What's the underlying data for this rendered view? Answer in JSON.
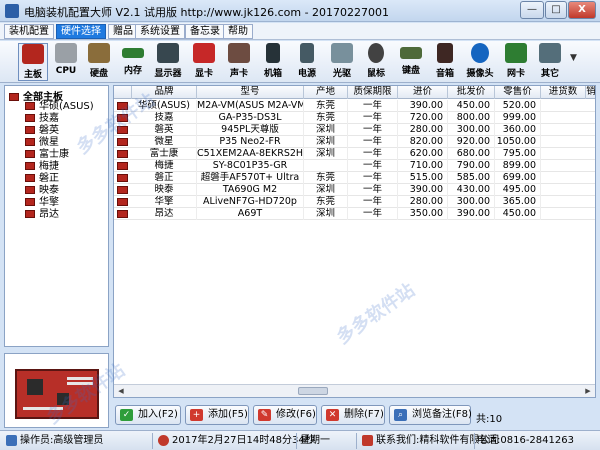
{
  "window": {
    "title": "电脑装机配置大师 V2.1 试用版 http://www.jk126.com - 20170227001",
    "min_label": "—",
    "max_label": "□",
    "close_label": "X"
  },
  "menu": [
    {
      "label": "装机配置"
    },
    {
      "label": "硬件选择",
      "active": true
    },
    {
      "label": "赠品"
    },
    {
      "label": "系统设置"
    },
    {
      "label": "备忘录"
    },
    {
      "label": "帮助"
    }
  ],
  "toolbar": [
    {
      "label": "主板",
      "icon": "motherboard-icon",
      "color": "#b3261e"
    },
    {
      "label": "CPU",
      "icon": "cpu-icon",
      "color": "#9aa0a6"
    },
    {
      "label": "硬盘",
      "icon": "harddisk-icon",
      "color": "#8a6d3b"
    },
    {
      "label": "内存",
      "icon": "memory-icon",
      "color": "#2e7d32"
    },
    {
      "label": "显示器",
      "icon": "monitor-icon",
      "color": "#37474f"
    },
    {
      "label": "显卡",
      "icon": "graphics-card-icon",
      "color": "#c62828"
    },
    {
      "label": "声卡",
      "icon": "sound-card-icon",
      "color": "#6d4c41"
    },
    {
      "label": "机箱",
      "icon": "case-icon",
      "color": "#263238"
    },
    {
      "label": "电源",
      "icon": "power-supply-icon",
      "color": "#455a64"
    },
    {
      "label": "光驱",
      "icon": "optical-drive-icon",
      "color": "#78909c"
    },
    {
      "label": "鼠标",
      "icon": "mouse-icon",
      "color": "#424242"
    },
    {
      "label": "键盘",
      "icon": "keyboard-icon",
      "color": "#4e6a3a"
    },
    {
      "label": "音箱",
      "icon": "speaker-icon",
      "color": "#3e2723"
    },
    {
      "label": "摄像头",
      "icon": "webcam-icon",
      "color": "#1565c0"
    },
    {
      "label": "网卡",
      "icon": "network-card-icon",
      "color": "#2e7d32"
    },
    {
      "label": "其它",
      "icon": "other-device-icon",
      "color": "#546e7a"
    }
  ],
  "tree": {
    "root": "全部主板",
    "items": [
      "华硕(ASUS)",
      "技嘉",
      "磐英",
      "微星",
      "富士康",
      "梅捷",
      "磐正",
      "映泰",
      "华擎",
      "昂达"
    ]
  },
  "table": {
    "columns": [
      "品牌",
      "型号",
      "产地",
      "质保期限",
      "进价",
      "批发价",
      "零售价",
      "进货数",
      "销"
    ],
    "rows": [
      [
        "华硕(ASUS)",
        "M2A-VM(ASUS M2A-VM)",
        "东莞",
        "一年",
        "390.00",
        "450.00",
        "520.00"
      ],
      [
        "技嘉",
        "GA-P35-DS3L",
        "东莞",
        "一年",
        "720.00",
        "800.00",
        "999.00"
      ],
      [
        "磐英",
        "945PL天尊版",
        "深圳",
        "一年",
        "280.00",
        "300.00",
        "360.00"
      ],
      [
        "微星",
        "P35 Neo2-FR",
        "深圳",
        "一年",
        "820.00",
        "920.00",
        "1050.00"
      ],
      [
        "富士康",
        "C51XEM2AA-8EKRS2H",
        "深圳",
        "一年",
        "620.00",
        "680.00",
        "795.00"
      ],
      [
        "梅捷",
        "SY-8C01P35-GR",
        "",
        "一年",
        "710.00",
        "790.00",
        "899.00"
      ],
      [
        "磐正",
        "超磐手AF570T+ Ultra",
        "东莞",
        "一年",
        "515.00",
        "585.00",
        "699.00"
      ],
      [
        "映泰",
        "TA690G M2",
        "深圳",
        "一年",
        "390.00",
        "430.00",
        "495.00"
      ],
      [
        "华擎",
        "ALiveNF7G-HD720p",
        "东莞",
        "一年",
        "280.00",
        "300.00",
        "365.00"
      ],
      [
        "昂达",
        "A69T",
        "深圳",
        "一年",
        "350.00",
        "390.00",
        "450.00"
      ]
    ]
  },
  "actions": {
    "add": "加入(F2)",
    "new": "添加(F5)",
    "edit": "修改(F6)",
    "delete": "删除(F7)",
    "notes": "浏览备注(F8)",
    "count": "共:10"
  },
  "status": {
    "operator": "操作员:高级管理员",
    "datetime": "2017年2月27日14时48分34秒",
    "weekday": "星期一",
    "contact": "联系我们:精科软件有限公司",
    "phone": "电话:0816-2841263"
  },
  "watermark": "多多软件站"
}
